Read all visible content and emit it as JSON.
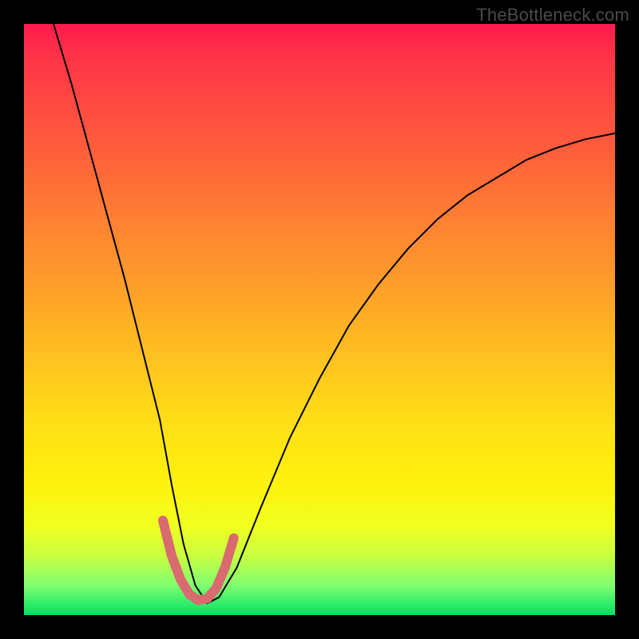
{
  "watermark": "TheBottleneck.com",
  "chart_data": {
    "type": "line",
    "title": "",
    "xlabel": "",
    "ylabel": "",
    "xlim": [
      0,
      100
    ],
    "ylim": [
      0,
      100
    ],
    "series": [
      {
        "name": "bottleneck-curve",
        "x": [
          5,
          8,
          11,
          14,
          17,
          20,
          23,
          25,
          27,
          29,
          31,
          33,
          36,
          40,
          45,
          50,
          55,
          60,
          65,
          70,
          75,
          80,
          85,
          90,
          95,
          100
        ],
        "y": [
          100,
          90,
          79,
          68,
          57,
          45,
          33,
          22,
          12,
          5,
          2,
          3,
          8,
          18,
          30,
          40,
          49,
          56,
          62,
          67,
          71,
          74,
          77,
          79,
          80.5,
          81.5
        ]
      },
      {
        "name": "highlight-segment",
        "x": [
          23.5,
          25,
          26.5,
          28,
          29.5,
          31,
          32.5,
          34,
          35.5
        ],
        "y": [
          16,
          10,
          6,
          3.5,
          2.5,
          2.8,
          4.5,
          8,
          13
        ]
      }
    ],
    "gradient_stops": [
      {
        "pos": 0,
        "color": "#ff1a4d"
      },
      {
        "pos": 20,
        "color": "#ff5a3d"
      },
      {
        "pos": 45,
        "color": "#ffa02a"
      },
      {
        "pos": 68,
        "color": "#ffe016"
      },
      {
        "pos": 90,
        "color": "#c8ff40"
      },
      {
        "pos": 100,
        "color": "#00e066"
      }
    ],
    "highlight_color": "#d96a6f"
  }
}
